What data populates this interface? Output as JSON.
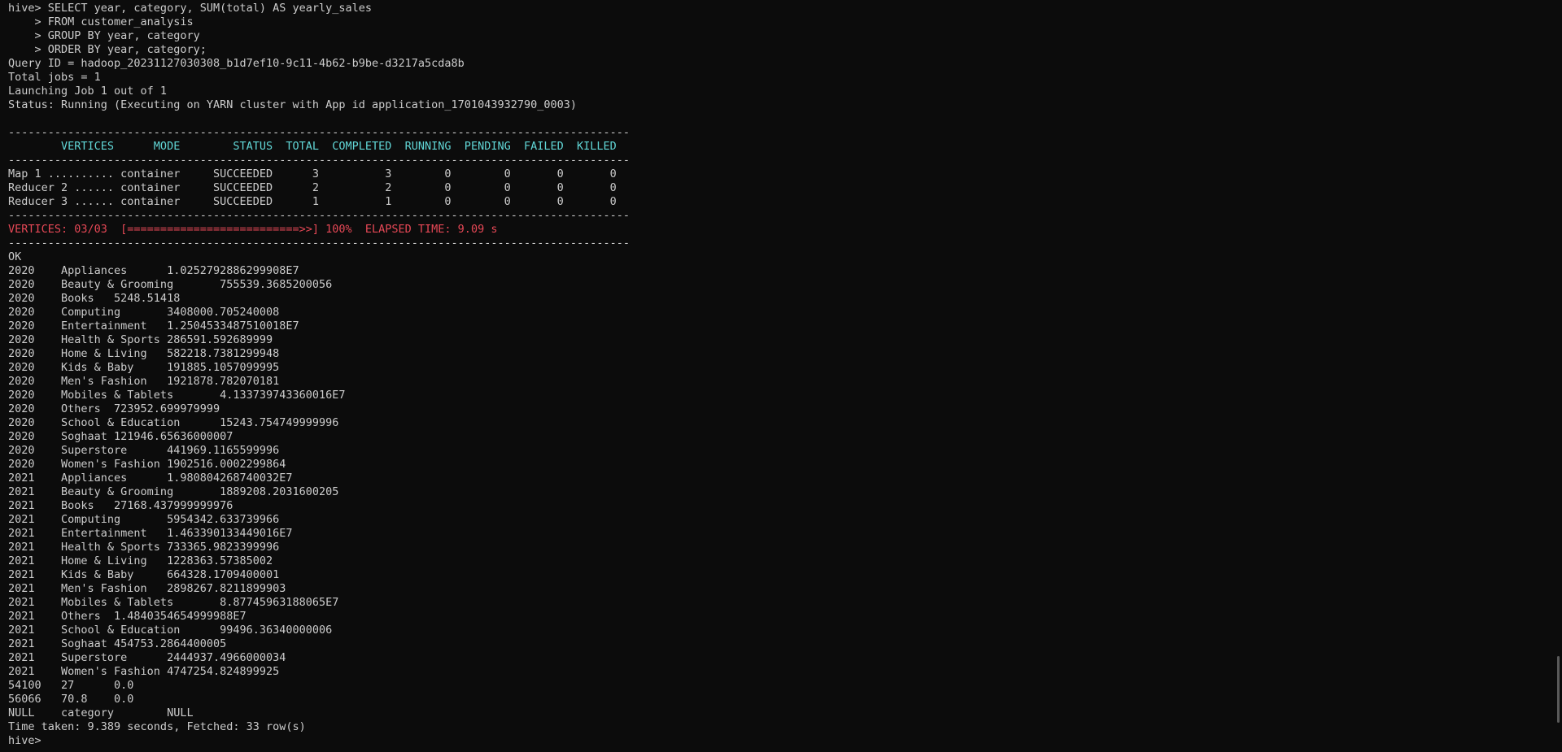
{
  "terminal": {
    "colors": {
      "background": "#0c0c0c",
      "text": "#cccccc",
      "header": "#61d6d6",
      "status": "#e74856"
    },
    "lines": [
      {
        "text": "hive> SELECT year, category, SUM(total) AS yearly_sales",
        "style": "normal"
      },
      {
        "text": "    > FROM customer_analysis",
        "style": "normal"
      },
      {
        "text": "    > GROUP BY year, category",
        "style": "normal"
      },
      {
        "text": "    > ORDER BY year, category;",
        "style": "normal"
      },
      {
        "text": "Query ID = hadoop_20231127030308_b1d7ef10-9c11-4b62-b9be-d3217a5cda8b",
        "style": "normal"
      },
      {
        "text": "Total jobs = 1",
        "style": "normal"
      },
      {
        "text": "Launching Job 1 out of 1",
        "style": "normal"
      },
      {
        "text": "Status: Running (Executing on YARN cluster with App id application_1701043932790_0003)",
        "style": "normal"
      },
      {
        "text": "",
        "style": "normal"
      },
      {
        "text": "----------------------------------------------------------------------------------------------",
        "style": "normal"
      },
      {
        "text": "        VERTICES      MODE        STATUS  TOTAL  COMPLETED  RUNNING  PENDING  FAILED  KILLED",
        "style": "header"
      },
      {
        "text": "----------------------------------------------------------------------------------------------",
        "style": "normal"
      },
      {
        "text": "Map 1 .......... container     SUCCEEDED      3          3        0        0       0       0",
        "style": "normal"
      },
      {
        "text": "Reducer 2 ...... container     SUCCEEDED      2          2        0        0       0       0",
        "style": "normal"
      },
      {
        "text": "Reducer 3 ...... container     SUCCEEDED      1          1        0        0       0       0",
        "style": "normal"
      },
      {
        "text": "----------------------------------------------------------------------------------------------",
        "style": "normal"
      },
      {
        "text": "VERTICES: 03/03  [==========================>>] 100%  ELAPSED TIME: 9.09 s",
        "style": "status"
      },
      {
        "text": "----------------------------------------------------------------------------------------------",
        "style": "normal"
      },
      {
        "text": "OK",
        "style": "normal"
      },
      {
        "text": "2020    Appliances      1.0252792886299908E7",
        "style": "normal"
      },
      {
        "text": "2020    Beauty & Grooming       755539.3685200056",
        "style": "normal"
      },
      {
        "text": "2020    Books   5248.51418",
        "style": "normal"
      },
      {
        "text": "2020    Computing       3408000.705240008",
        "style": "normal"
      },
      {
        "text": "2020    Entertainment   1.2504533487510018E7",
        "style": "normal"
      },
      {
        "text": "2020    Health & Sports 286591.592689999",
        "style": "normal"
      },
      {
        "text": "2020    Home & Living   582218.7381299948",
        "style": "normal"
      },
      {
        "text": "2020    Kids & Baby     191885.1057099995",
        "style": "normal"
      },
      {
        "text": "2020    Men's Fashion   1921878.782070181",
        "style": "normal"
      },
      {
        "text": "2020    Mobiles & Tablets       4.133739743360016E7",
        "style": "normal"
      },
      {
        "text": "2020    Others  723952.699979999",
        "style": "normal"
      },
      {
        "text": "2020    School & Education      15243.754749999996",
        "style": "normal"
      },
      {
        "text": "2020    Soghaat 121946.65636000007",
        "style": "normal"
      },
      {
        "text": "2020    Superstore      441969.1165599996",
        "style": "normal"
      },
      {
        "text": "2020    Women's Fashion 1902516.0002299864",
        "style": "normal"
      },
      {
        "text": "2021    Appliances      1.980804268740032E7",
        "style": "normal"
      },
      {
        "text": "2021    Beauty & Grooming       1889208.2031600205",
        "style": "normal"
      },
      {
        "text": "2021    Books   27168.437999999976",
        "style": "normal"
      },
      {
        "text": "2021    Computing       5954342.633739966",
        "style": "normal"
      },
      {
        "text": "2021    Entertainment   1.463390133449016E7",
        "style": "normal"
      },
      {
        "text": "2021    Health & Sports 733365.9823399996",
        "style": "normal"
      },
      {
        "text": "2021    Home & Living   1228363.57385002",
        "style": "normal"
      },
      {
        "text": "2021    Kids & Baby     664328.1709400001",
        "style": "normal"
      },
      {
        "text": "2021    Men's Fashion   2898267.8211899903",
        "style": "normal"
      },
      {
        "text": "2021    Mobiles & Tablets       8.87745963188065E7",
        "style": "normal"
      },
      {
        "text": "2021    Others  1.4840354654999988E7",
        "style": "normal"
      },
      {
        "text": "2021    School & Education      99496.36340000006",
        "style": "normal"
      },
      {
        "text": "2021    Soghaat 454753.2864400005",
        "style": "normal"
      },
      {
        "text": "2021    Superstore      2444937.4966000034",
        "style": "normal"
      },
      {
        "text": "2021    Women's Fashion 4747254.824899925",
        "style": "normal"
      },
      {
        "text": "54100   27      0.0",
        "style": "normal"
      },
      {
        "text": "56066   70.8    0.0",
        "style": "normal"
      },
      {
        "text": "NULL    category        NULL",
        "style": "normal"
      },
      {
        "text": "Time taken: 9.389 seconds, Fetched: 33 row(s)",
        "style": "normal"
      },
      {
        "text": "hive> ",
        "style": "normal"
      }
    ]
  }
}
